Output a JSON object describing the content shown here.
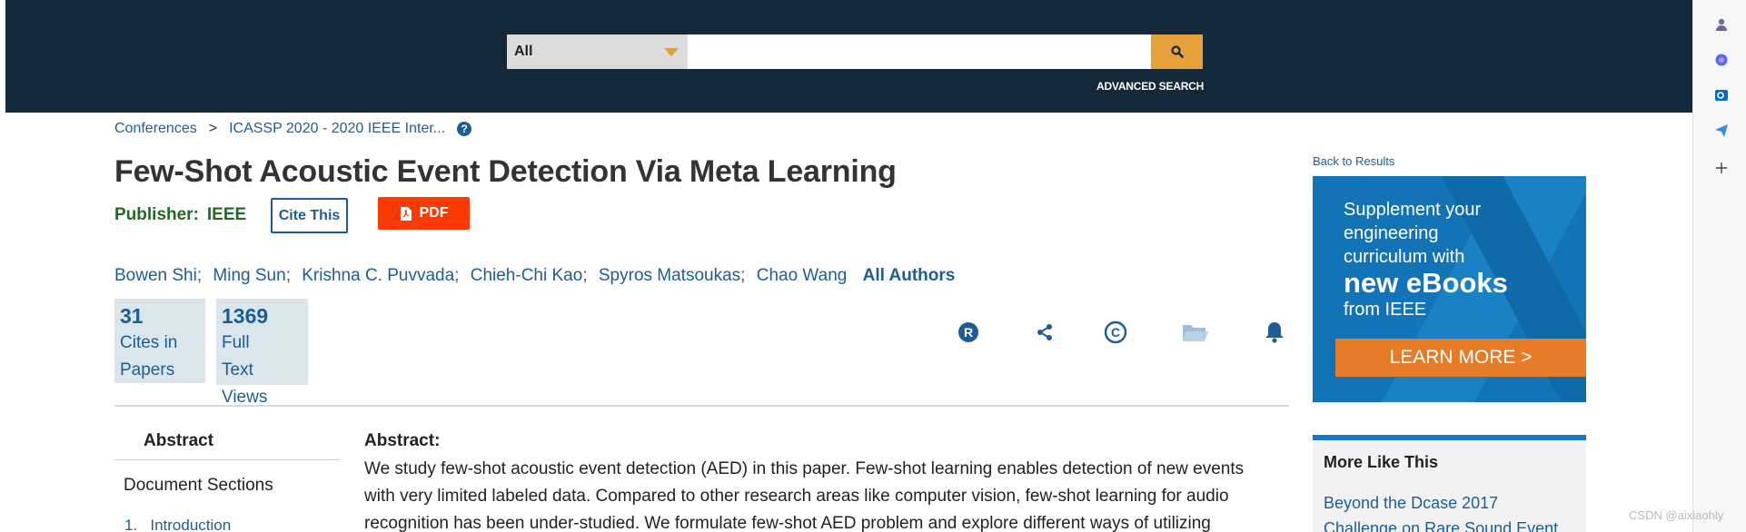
{
  "search": {
    "scope": "All",
    "query": "",
    "advanced": "ADVANCED SEARCH"
  },
  "breadcrumb": {
    "conferences": "Conferences",
    "separator": ">",
    "conference": "ICASSP 2020 - 2020 IEEE Inter..."
  },
  "paper": {
    "title": "Few-Shot Acoustic Event Detection Via Meta Learning",
    "publisher_label": "Publisher:",
    "publisher": "IEEE",
    "cite_label": "Cite This",
    "pdf_label": "PDF",
    "authors": [
      "Bowen Shi",
      "Ming Sun",
      "Krishna C. Puvvada",
      "Chieh-Chi Kao",
      "Spyros Matsoukas",
      "Chao Wang"
    ],
    "all_authors": "All Authors"
  },
  "metrics": {
    "cites": {
      "value": "31",
      "line1": "Cites in",
      "line2": "Papers"
    },
    "views": {
      "value": "1369",
      "line1": "Full",
      "line2": "Text",
      "line3": "Views"
    }
  },
  "toolbar_icons": [
    "rights-icon",
    "share-icon",
    "copyright-icon",
    "folder-icon",
    "alert-bell-icon"
  ],
  "left_nav": {
    "abstract_tab": "Abstract",
    "document_sections": "Document Sections",
    "first_section": "1.   Introduction"
  },
  "abstract": {
    "heading": "Abstract:",
    "text": "We study few-shot acoustic event detection (AED) in this paper. Few-shot learning enables detection of new events with very limited labeled data. Compared to other research areas like computer vision, few-shot learning for audio recognition has been under-studied. We formulate few-shot AED problem and explore different ways of utilizing"
  },
  "sidebar": {
    "back": "Back to Results",
    "ad": {
      "line1": "Supplement your",
      "line2": "engineering",
      "line3": "curriculum with",
      "line4": "new eBooks",
      "line5": "from IEEE",
      "button": "LEARN MORE >"
    },
    "more_like_this": {
      "heading": "More Like This",
      "link_line1": "Beyond the Dcase 2017",
      "link_line2": "Challenge on Rare Sound Event"
    }
  },
  "watermark": "CSDN @aixiaohly",
  "colors": {
    "header_bg": "#14293a",
    "link_blue": "#1d5d96",
    "search_button": "#e6a13b",
    "pdf_red": "#fa3a00",
    "publisher_green": "#206b1f",
    "ad_orange": "#e67c28"
  }
}
